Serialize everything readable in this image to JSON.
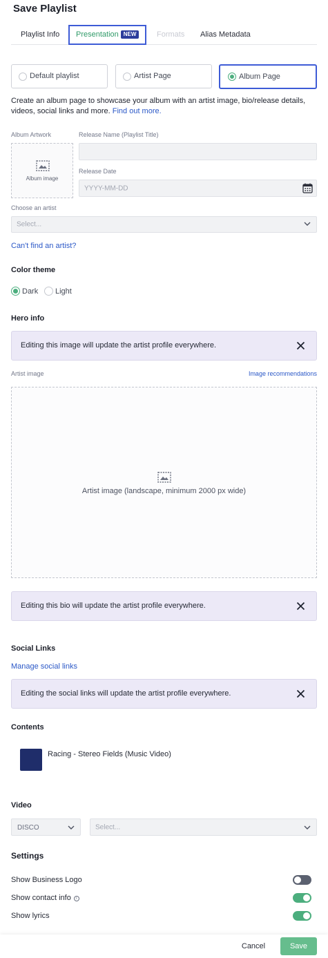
{
  "header": {
    "title": "Save Playlist"
  },
  "tabs": [
    {
      "label": "Playlist Info"
    },
    {
      "label": "Presentation",
      "badge": "NEW"
    },
    {
      "label": "Formats"
    },
    {
      "label": "Alias Metadata"
    }
  ],
  "page_types": [
    {
      "label": "Default playlist",
      "selected": false
    },
    {
      "label": "Artist Page",
      "selected": false
    },
    {
      "label": "Album Page",
      "selected": true
    }
  ],
  "description": {
    "text": "Create an album page to showcase your album with an artist image, bio/release details, videos, social links and more.",
    "link": "Find out more."
  },
  "album": {
    "artwork_label": "Album Artwork",
    "artwork_placeholder": "Album image",
    "release_name_label": "Release Name (Playlist Title)",
    "release_name_value": "",
    "release_date_label": "Release Date",
    "release_date_placeholder": "YYYY-MM-DD",
    "artist_label": "Choose an artist",
    "artist_placeholder": "Select...",
    "cant_find_link": "Can't find an artist?"
  },
  "color_theme": {
    "title": "Color theme",
    "options": [
      {
        "label": "Dark",
        "selected": true
      },
      {
        "label": "Light",
        "selected": false
      }
    ]
  },
  "hero": {
    "title": "Hero info",
    "notice": "Editing this image will update the artist profile everywhere.",
    "artist_image_label": "Artist image",
    "recommendations_link": "Image recommendations",
    "dropzone_text": "Artist image (landscape, minimum 2000 px wide)",
    "bio_notice": "Editing this bio will update the artist profile everywhere."
  },
  "social": {
    "title": "Social Links",
    "manage_link": "Manage social links",
    "notice": "Editing the social links will update the artist profile everywhere."
  },
  "contents": {
    "title": "Contents",
    "items": [
      {
        "title": "Racing - Stereo Fields (Music Video)"
      }
    ]
  },
  "video": {
    "title": "Video",
    "source_value": "DISCO",
    "select_placeholder": "Select..."
  },
  "settings": {
    "title": "Settings",
    "items": [
      {
        "label": "Show Business Logo",
        "enabled": false
      },
      {
        "label": "Show contact info",
        "enabled": true,
        "info": "i"
      },
      {
        "label": "Show lyrics",
        "enabled": true
      }
    ]
  },
  "footer": {
    "cancel_label": "Cancel",
    "save_label": "Save"
  },
  "colors": {
    "accent_green": "#4cae7e",
    "focus_blue": "#3d5bd6",
    "link_blue": "#2b58c7",
    "notice_bg": "#ece9f7",
    "badge_bg": "#2c3d9c",
    "thumb_bg": "#1f2d6a"
  }
}
